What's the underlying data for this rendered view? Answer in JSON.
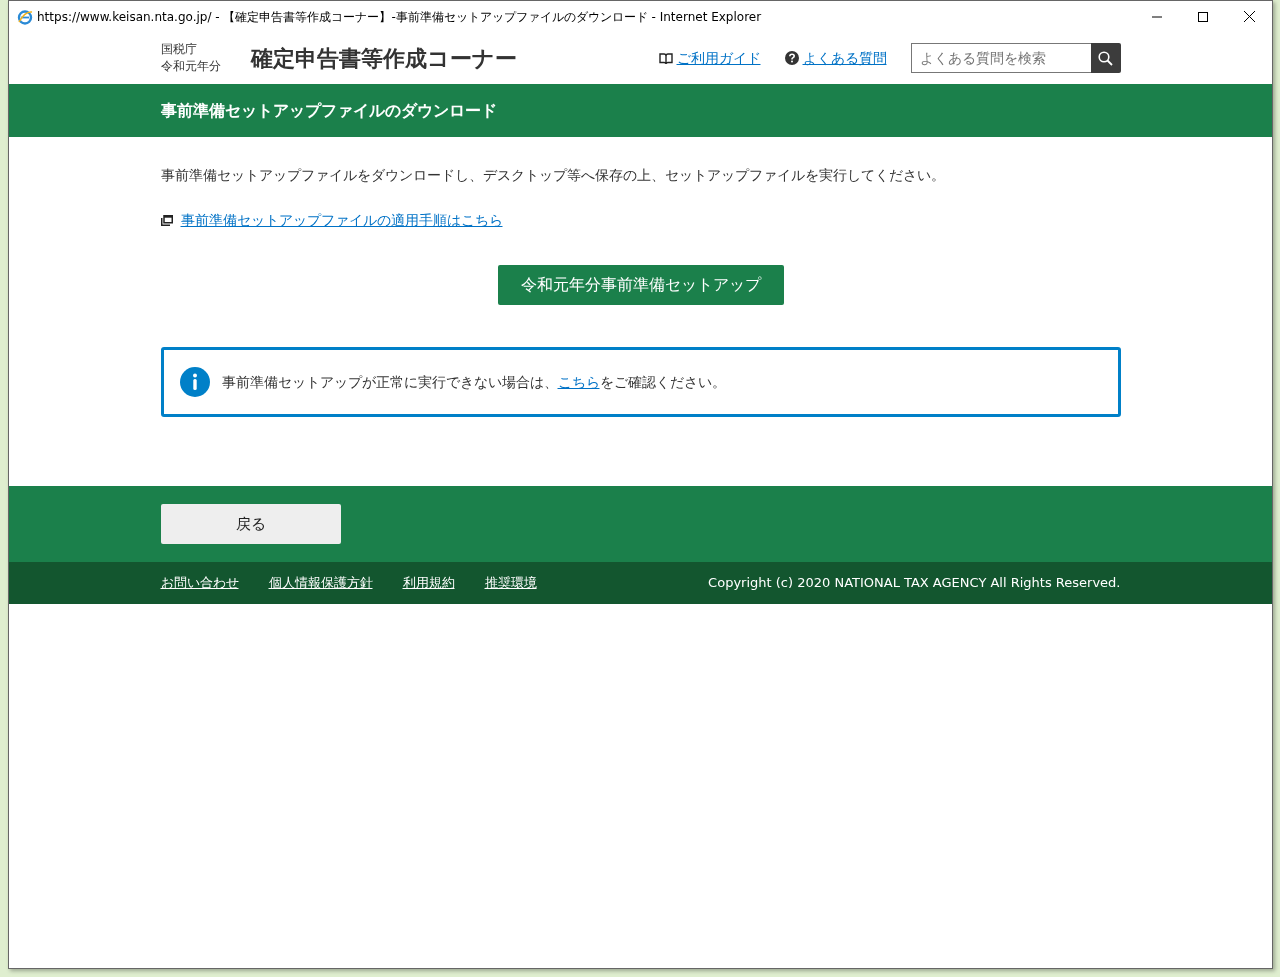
{
  "window": {
    "title": "https://www.keisan.nta.go.jp/ - 【確定申告書等作成コーナー】-事前準備セットアップファイルのダウンロード - Internet Explorer"
  },
  "header": {
    "agency": "国税庁",
    "year": "令和元年分",
    "site_title": "確定申告書等作成コーナー",
    "links": [
      {
        "kind": "guide",
        "label": "ご利用ガイド"
      },
      {
        "kind": "faq",
        "label": "よくある質問"
      }
    ],
    "search": {
      "placeholder": "よくある質問を検索"
    }
  },
  "page_title": "事前準備セットアップファイルのダウンロード",
  "intro": "事前準備セットアップファイルをダウンロードし、デスクトップ等へ保存の上、セットアップファイルを実行してください。",
  "procedure_link": "事前準備セットアップファイルの適用手順はこちら",
  "setup_button": "令和元年分事前準備セットアップ",
  "notice": {
    "before": "事前準備セットアップが正常に実行できない場合は、",
    "link": "こちら",
    "after": "をご確認ください。"
  },
  "back_button": "戻る",
  "footer": {
    "links": [
      "お問い合わせ",
      "個人情報保護方針",
      "利用規約",
      "推奨環境"
    ],
    "copyright": "Copyright (c) 2020 NATIONAL TAX AGENCY All Rights Reserved."
  }
}
